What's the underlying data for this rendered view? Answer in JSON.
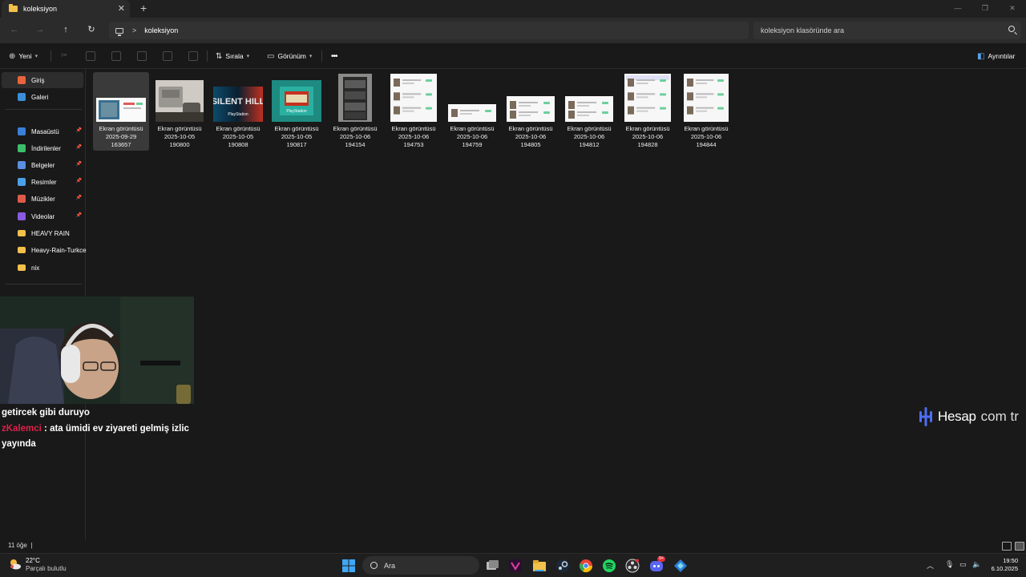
{
  "window": {
    "tab_title": "koleksiyon",
    "tab_close": "✕",
    "new_tab": "+",
    "controls": [
      "—",
      "❐",
      "✕"
    ]
  },
  "addressbar": {
    "path": "koleksiyon",
    "search_placeholder": "koleksiyon klasöründe ara"
  },
  "commandbar": {
    "new_label": "Yeni",
    "sort_label": "Sırala",
    "view_label": "Görünüm",
    "more": "•••",
    "details_label": "Ayrıntılar"
  },
  "sidebar": {
    "items": [
      {
        "label": "Giriş",
        "icon": "home-icon",
        "color": "#e8643c"
      },
      {
        "label": "Galeri",
        "icon": "gallery-icon",
        "color": "#3a8fd8"
      },
      {
        "label": "Masaüstü",
        "icon": "desktop-icon",
        "color": "#3a7fd8",
        "pinned": true
      },
      {
        "label": "İndirilenler",
        "icon": "download-icon",
        "color": "#3cbf6a",
        "pinned": true
      },
      {
        "label": "Belgeler",
        "icon": "documents-icon",
        "color": "#5a8fe0",
        "pinned": true
      },
      {
        "label": "Resimler",
        "icon": "pictures-icon",
        "color": "#4aa0e8",
        "pinned": true
      },
      {
        "label": "Müzikler",
        "icon": "music-icon",
        "color": "#e05a4a",
        "pinned": true
      },
      {
        "label": "Videolar",
        "icon": "videos-icon",
        "color": "#8a5ae0",
        "pinned": true
      },
      {
        "label": "HEAVY RAIN",
        "icon": "folder-icon",
        "color": "#f2c14b"
      },
      {
        "label": "Heavy-Rain-Turkce",
        "icon": "folder-icon",
        "color": "#f2c14b"
      },
      {
        "label": "nix",
        "icon": "folder-icon",
        "color": "#f2c14b"
      }
    ]
  },
  "files": [
    {
      "line1": "Ekran görüntüsü",
      "line2": "2025-09-29",
      "line3": "163657"
    },
    {
      "line1": "Ekran görüntüsü",
      "line2": "2025-10-05",
      "line3": "190800"
    },
    {
      "line1": "Ekran görüntüsü",
      "line2": "2025-10-05",
      "line3": "190808"
    },
    {
      "line1": "Ekran görüntüsü",
      "line2": "2025-10-05",
      "line3": "190817"
    },
    {
      "line1": "Ekran görüntüsü",
      "line2": "2025-10-06",
      "line3": "194154"
    },
    {
      "line1": "Ekran görüntüsü",
      "line2": "2025-10-06",
      "line3": "194753"
    },
    {
      "line1": "Ekran görüntüsü",
      "line2": "2025-10-06",
      "line3": "194759"
    },
    {
      "line1": "Ekran görüntüsü",
      "line2": "2025-10-06",
      "line3": "194805"
    },
    {
      "line1": "Ekran görüntüsü",
      "line2": "2025-10-06",
      "line3": "194812"
    },
    {
      "line1": "Ekran görüntüsü",
      "line2": "2025-10-06",
      "line3": "194828"
    },
    {
      "line1": "Ekran görüntüsü",
      "line2": "2025-10-06",
      "line3": "194844"
    }
  ],
  "thumbs": {
    "silent_hill_text": "SILENT HILL",
    "ps_text": "PlayStation"
  },
  "stream": {
    "chat_line1": "getircek gibi duruyo",
    "chat_user": "zKalemci",
    "chat_line2": " : ata ümidi ev ziyareti gelmiş izlic",
    "chat_line3": "yayında"
  },
  "watermark": {
    "brand": "Hesap",
    "tld": "com tr"
  },
  "status": {
    "item_count": "11 öğe",
    "cursor": "|"
  },
  "taskbar": {
    "temperature": "22°C",
    "condition": "Parçalı bulutlu",
    "search_placeholder": "Ara",
    "time": "19:50",
    "date": "6.10.2025",
    "discord_badge": "9+"
  }
}
